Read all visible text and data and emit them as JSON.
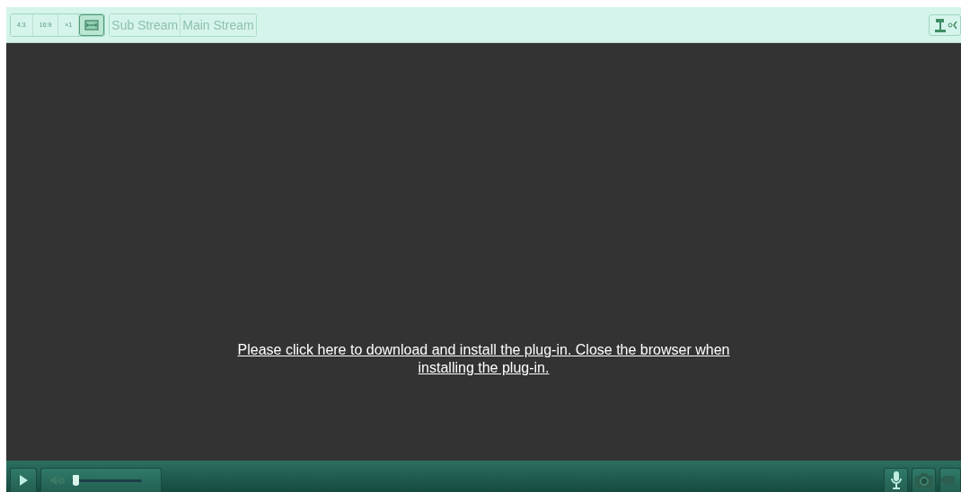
{
  "toolbar": {
    "ratios": [
      {
        "kind": "text",
        "label": "4:3",
        "selected": false
      },
      {
        "kind": "text",
        "label": "16:9",
        "selected": false
      },
      {
        "kind": "text",
        "label": "×1",
        "selected": false
      },
      {
        "kind": "fit",
        "selected": true
      }
    ],
    "streams": [
      "Sub Stream",
      "Main Stream"
    ]
  },
  "message": {
    "line_1": "Please click here to download and install the plug-in. Close the browser when",
    "line_2": "installing the plug-in."
  },
  "controls": {
    "volume": {
      "level": 0.05
    }
  }
}
